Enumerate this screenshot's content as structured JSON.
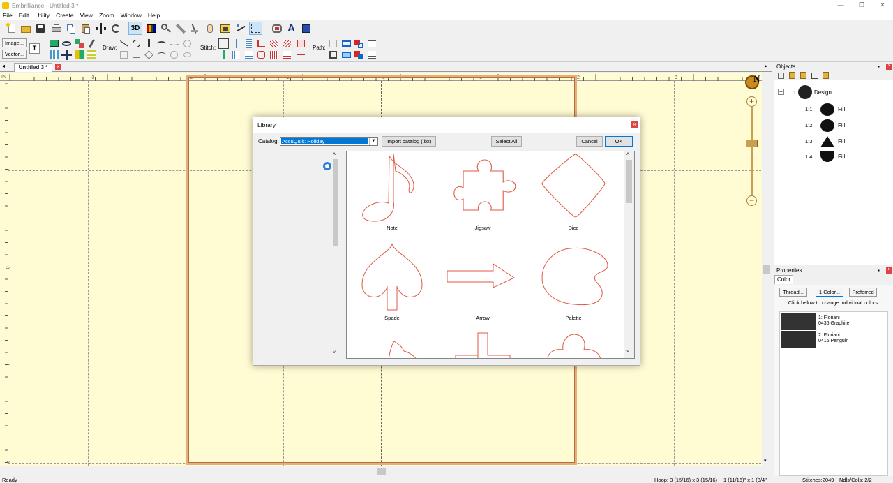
{
  "app": {
    "title": "Embrilliance - Untitled 3 *",
    "window_controls": [
      "—",
      "❐",
      "✕"
    ]
  },
  "menu": [
    "File",
    "Edit",
    "Utility",
    "Create",
    "View",
    "Zoom",
    "Window",
    "Help"
  ],
  "toolbar": {
    "image_button": "Image...",
    "vector_button": "Vector...",
    "draw_label": "Draw:",
    "stitch_label": "Stitch:",
    "path_label": "Path:",
    "text_tool": "A",
    "view_3d": "3D"
  },
  "document_tab": {
    "label": "Untitled 3 *",
    "close": "×"
  },
  "ruler": {
    "unit": "IN",
    "h_labels": [
      "-3",
      "-2",
      "-1",
      "0",
      "1",
      "2",
      "3"
    ],
    "v_labels": [
      "1",
      "0",
      "1",
      "2"
    ]
  },
  "compass": "N",
  "objects_panel": {
    "title": "Objects",
    "design_label": "Design",
    "design_index": "1",
    "items": [
      {
        "index": "1:1",
        "label": "Fill"
      },
      {
        "index": "1:2",
        "label": "Fill"
      },
      {
        "index": "1:3",
        "label": "Fill"
      },
      {
        "index": "1:4",
        "label": "Fill"
      }
    ]
  },
  "properties_panel": {
    "title": "Properties",
    "tab": "Color",
    "thread_button": "Thread...",
    "color_button": "1 Color...",
    "preferred_button": "Preferred",
    "hint": "Click below to change individual colors.",
    "threads": [
      {
        "line1": "1: Floriani",
        "line2": "0436 Graphite",
        "color": "#333333"
      },
      {
        "line1": "2: Floriani",
        "line2": "0416 Penguin",
        "color": "#2f2f2f"
      }
    ]
  },
  "status": {
    "left": "Ready",
    "hoop": "Hoop: 3 (15/16) x 3 (15/16)",
    "size": "1 (11/16)\" x 1 (3/4\"",
    "stitches": "Stitches:2049",
    "ndls": "Ndls/Cols: 2/2"
  },
  "dialog": {
    "title": "Library",
    "catalog_label": "Catalog:",
    "catalog_value": "AccuQuilt: Holiday",
    "import_button": "Import catalog (.bx)",
    "select_all_button": "Select All",
    "cancel_button": "Cancel",
    "ok_button": "OK",
    "shapes": [
      {
        "label": "Note",
        "shape": "note-shape"
      },
      {
        "label": "Jigsaw",
        "shape": "jigsaw-shape"
      },
      {
        "label": "Dice",
        "shape": "dice-shape"
      },
      {
        "label": "Spade",
        "shape": "spade-shape"
      },
      {
        "label": "Arrow",
        "shape": "arrow-shape"
      },
      {
        "label": "Palette",
        "shape": "palette-shape"
      }
    ],
    "outline_color": "#e05a45"
  }
}
